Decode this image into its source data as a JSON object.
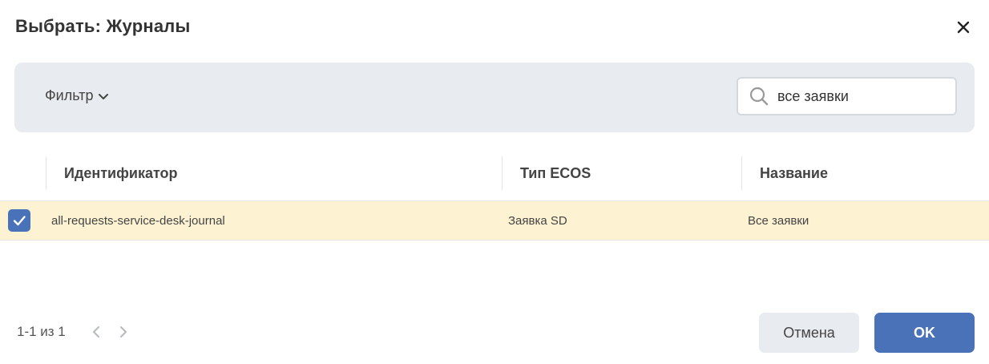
{
  "dialog": {
    "title": "Выбрать: Журналы",
    "close_icon": "close-icon"
  },
  "filter": {
    "label": "Фильтр",
    "toggle_icon": "chevron-down-icon"
  },
  "search": {
    "value": "все заявки",
    "icon": "search-icon"
  },
  "table": {
    "columns": [
      "Идентификатор",
      "Тип ECOS",
      "Название"
    ],
    "rows": [
      {
        "selected": true,
        "identifier": "all-requests-service-desk-journal",
        "ecos_type": "Заявка SD",
        "name": "Все заявки"
      }
    ]
  },
  "pagination": {
    "range_text": "1-1 из 1",
    "prev_icon": "chevron-left-icon",
    "next_icon": "chevron-right-icon"
  },
  "footer": {
    "cancel_label": "Отмена",
    "ok_label": "OK"
  },
  "colors": {
    "accent": "#4a72b8",
    "selected_row": "#fdf3d3",
    "filter_bar": "#e8ecf0"
  }
}
